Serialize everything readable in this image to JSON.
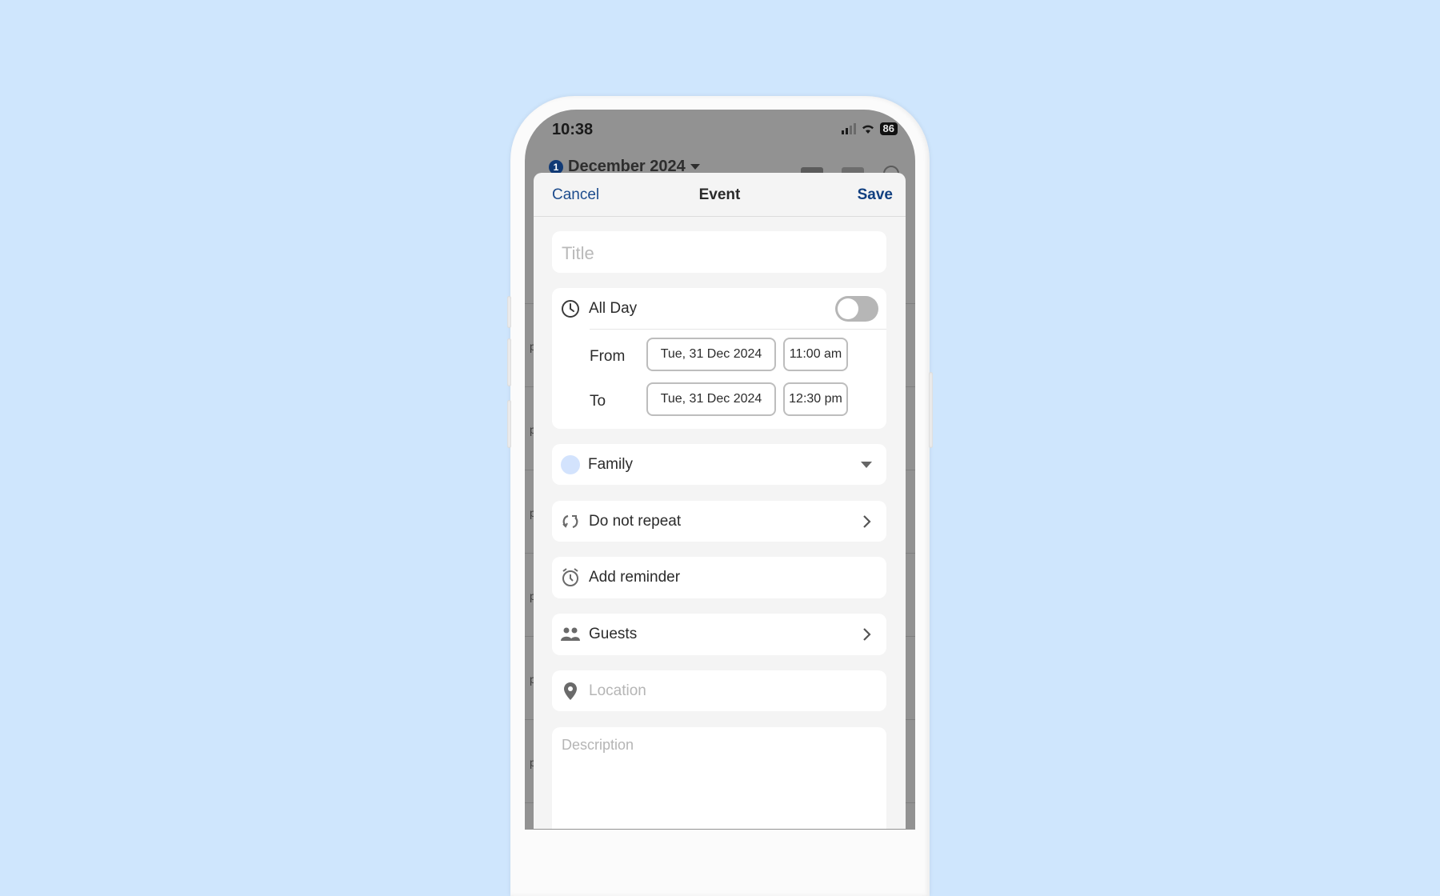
{
  "status_bar": {
    "time": "10:38",
    "battery": "86",
    "icons": [
      "signal-icon",
      "wifi-icon",
      "battery-icon"
    ]
  },
  "background_screen": {
    "badge_count": "1",
    "month_title": "December 2024",
    "icons": [
      "calendar-view-icon",
      "grid-view-icon",
      "search-icon"
    ],
    "row_marker": "p"
  },
  "sheet": {
    "header": {
      "cancel_label": "Cancel",
      "title": "Event",
      "save_label": "Save"
    },
    "title_field": {
      "placeholder": "Title",
      "value": ""
    },
    "all_day": {
      "label": "All Day",
      "enabled": false,
      "from_label": "From",
      "from_date": "Tue, 31 Dec 2024",
      "from_time": "11:00 am",
      "to_label": "To",
      "to_date": "Tue, 31 Dec 2024",
      "to_time": "12:30 pm"
    },
    "calendar_select": {
      "selected": "Family",
      "color": "#d3e3fd"
    },
    "repeat": {
      "label": "Do not repeat"
    },
    "reminder": {
      "label": "Add reminder"
    },
    "guests": {
      "label": "Guests"
    },
    "location": {
      "placeholder": "Location",
      "value": ""
    },
    "description": {
      "placeholder": "Description",
      "value": ""
    }
  },
  "colors": {
    "accent": "#1d4c8d",
    "save": "#113f80",
    "background": "#cfe6fd"
  }
}
